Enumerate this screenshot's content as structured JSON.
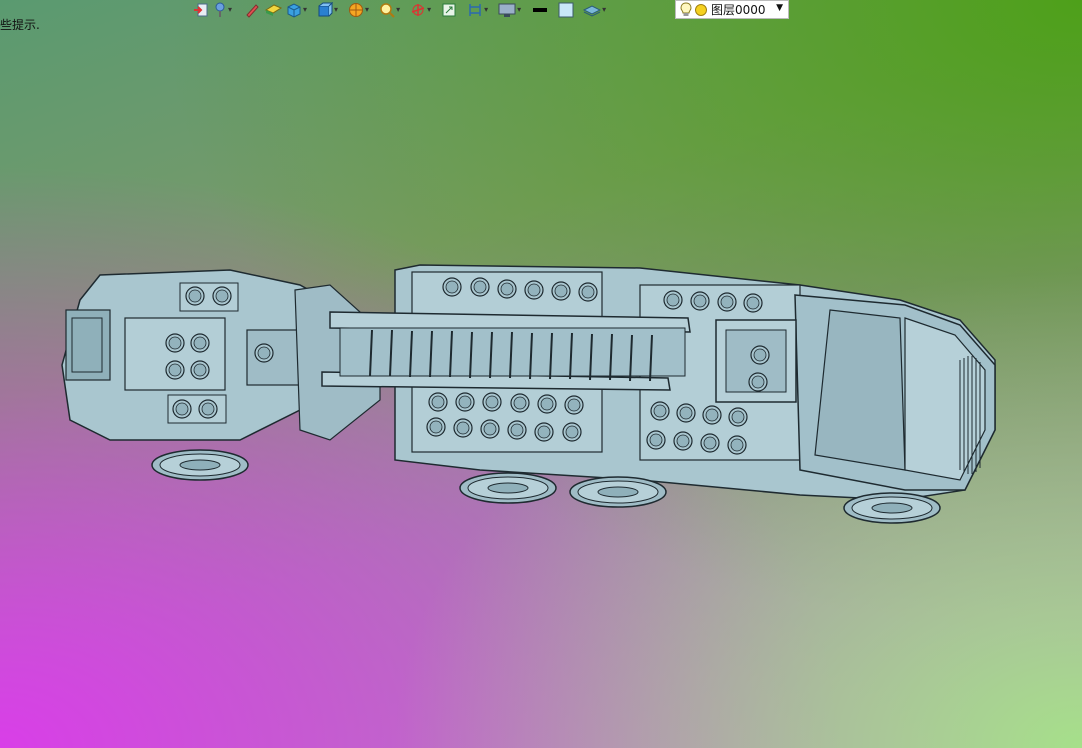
{
  "status": {
    "hint_text": "些提示."
  },
  "toolbar": {
    "buttons": [
      {
        "icon": "exit-arrow-icon",
        "dropdown": false
      },
      {
        "icon": "light-pin-icon",
        "dropdown": true
      },
      {
        "icon": "pencil-icon",
        "dropdown": false
      },
      {
        "icon": "plane-box-icon",
        "dropdown": false
      },
      {
        "icon": "solid-cube-icon",
        "dropdown": true
      },
      {
        "icon": "view-cube-icon",
        "dropdown": true
      },
      {
        "icon": "render-sphere-icon",
        "dropdown": true
      },
      {
        "icon": "zoom-icon",
        "dropdown": true
      },
      {
        "icon": "rotate-axis-icon",
        "dropdown": true
      },
      {
        "icon": "fit-view-icon",
        "dropdown": false
      },
      {
        "icon": "section-icon",
        "dropdown": true
      },
      {
        "icon": "display-icon",
        "dropdown": true
      },
      {
        "icon": "line-color-icon",
        "dropdown": false
      },
      {
        "icon": "face-color-icon",
        "dropdown": false
      },
      {
        "icon": "layers-icon",
        "dropdown": true
      }
    ]
  },
  "layer": {
    "current": "图层0000"
  },
  "colors": {
    "model_fill": "#a9c6cf",
    "model_stroke": "#1e2a30",
    "model_shadow": "#7f9ba5"
  }
}
